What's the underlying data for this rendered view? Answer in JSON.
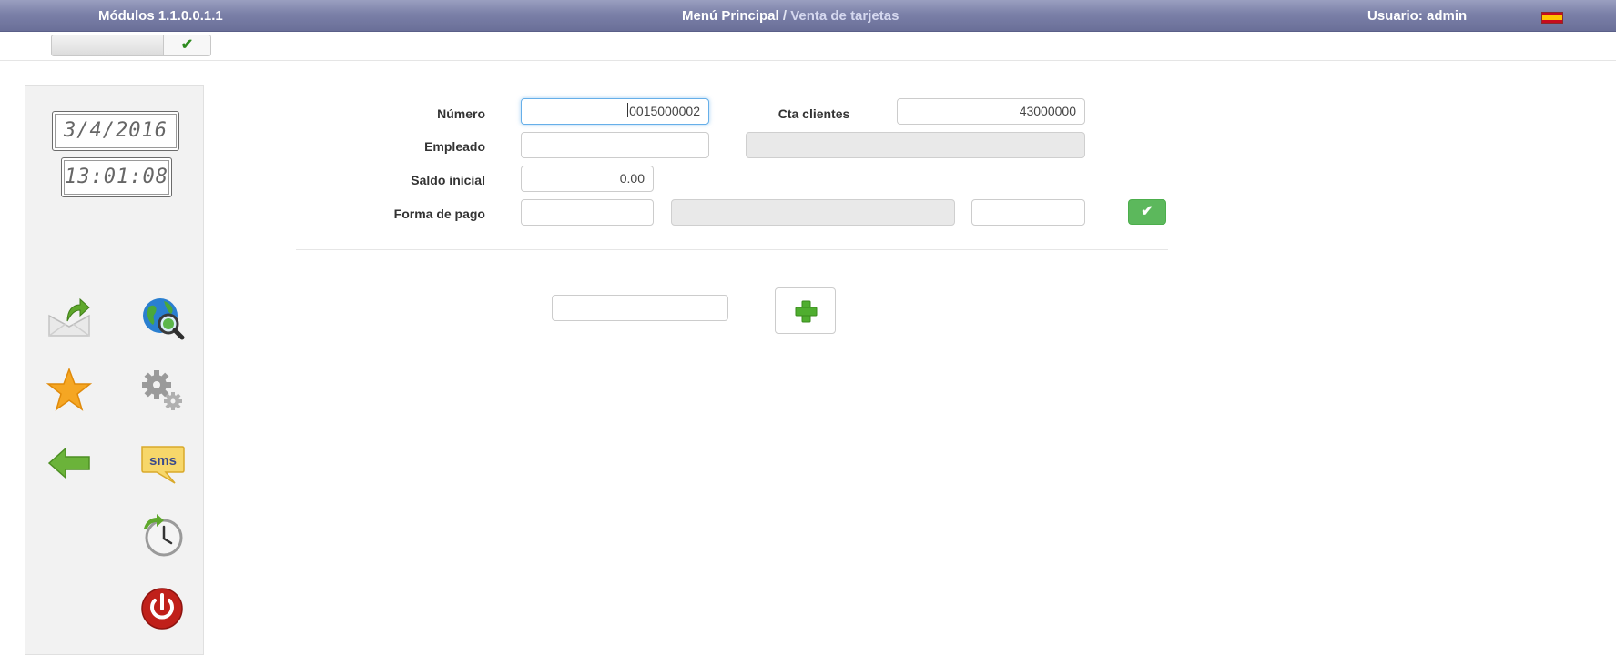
{
  "header": {
    "modules_title": "Módulos 1.1.0.0.1.1",
    "menu_principal": "Menú Principal",
    "separator": "/",
    "current_page": "Venta de tarjetas",
    "user_label": "Usuario: admin",
    "language_flag_icon": "spain-flag-icon"
  },
  "module_selector": {
    "value": "",
    "confirm_icon": "checkmark-icon"
  },
  "sidebar": {
    "date": "3/4/2016",
    "time": "13:01:08",
    "icons": [
      "mail-send-icon",
      "globe-search-icon",
      "star-favorite-icon",
      "gears-settings-icon",
      "arrow-back-icon",
      "sms-icon",
      "clock-history-icon",
      "power-off-icon"
    ]
  },
  "form": {
    "numero_label": "Número",
    "numero_value": "0015000002",
    "cta_clientes_label": "Cta clientes",
    "cta_clientes_value": "43000000",
    "empleado_label": "Empleado",
    "empleado_value": "",
    "empleado_name_value": "",
    "saldo_inicial_label": "Saldo inicial",
    "saldo_inicial_value": "0.00",
    "forma_pago_label": "Forma de pago",
    "forma_pago_code": "",
    "forma_pago_desc": "",
    "forma_pago_extra": "",
    "confirm_icon": "checkmark-icon"
  },
  "add_section": {
    "input_value": "",
    "add_icon": "plus-icon"
  },
  "colors": {
    "header_bg": "#7b80a8",
    "confirm_green": "#5cb85c",
    "focus_blue": "#66afe9",
    "power_red": "#c0201a"
  }
}
